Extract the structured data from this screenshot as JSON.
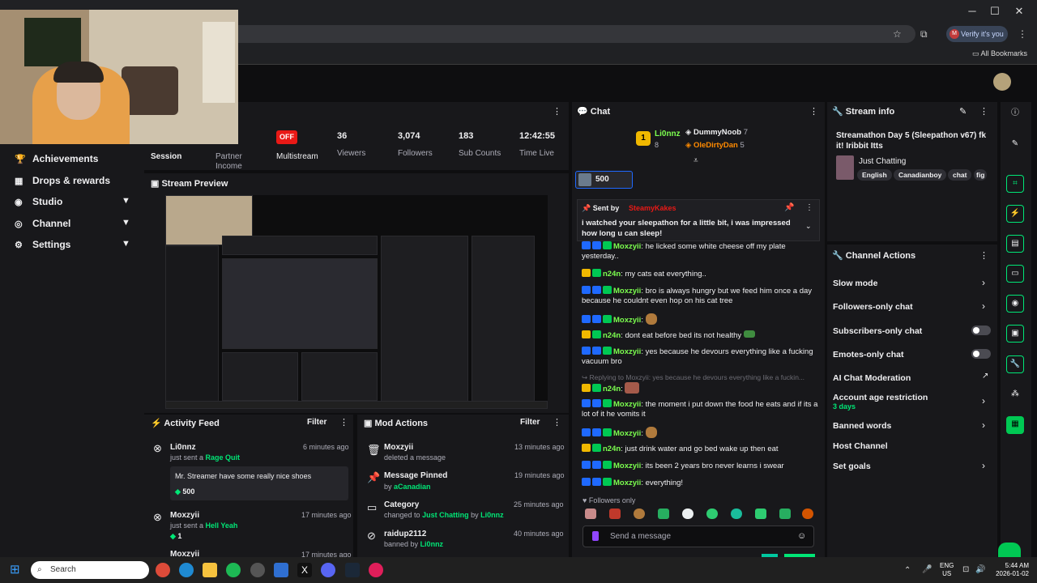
{
  "browser": {
    "verify_label": "Verify it's you",
    "verify_initial": "M",
    "all_bookmarks": "All Bookmarks"
  },
  "nav": {
    "items": [
      {
        "label": "Achievements"
      },
      {
        "label": "Drops & rewards"
      },
      {
        "label": "Studio"
      },
      {
        "label": "Channel"
      },
      {
        "label": "Settings"
      }
    ]
  },
  "stats": {
    "session": "Session",
    "partner_income": "Partner Income",
    "multistream_badge": "OFF",
    "multistream": "Multistream",
    "viewers_value": "36",
    "viewers": "Viewers",
    "followers_value": "3,074",
    "followers": "Followers",
    "subs_value": "183",
    "subs": "Sub Counts",
    "time_value": "12:42:55",
    "time": "Time Live"
  },
  "preview": {
    "title": "Stream Preview"
  },
  "activity": {
    "title": "Activity Feed",
    "filter": "Filter",
    "items": [
      {
        "user": "Li0nnz",
        "time": "6 minutes ago",
        "action": "just sent a",
        "reward": "Rage Quit",
        "message": "Mr. Streamer have some really nice shoes",
        "amount": "500"
      },
      {
        "user": "Moxzyii",
        "time": "17 minutes ago",
        "action": "just sent a",
        "reward": "Hell Yeah",
        "amount": "1"
      },
      {
        "user": "Moxzyii",
        "time": "17 minutes ago"
      }
    ]
  },
  "mod": {
    "title": "Mod Actions",
    "filter": "Filter",
    "items": [
      {
        "title": "Moxzyii",
        "sub": "deleted a message",
        "time": "13 minutes ago"
      },
      {
        "title": "Message Pinned",
        "sub_prefix": "by",
        "sub_user": "aCanadian",
        "time": "19 minutes ago"
      },
      {
        "title": "Category",
        "sub_prefix": "changed to",
        "sub_user": "Just Chatting",
        "sub_mid": "by",
        "sub_user2": "Li0nnz",
        "time": "25 minutes ago"
      },
      {
        "title": "raidup2112",
        "sub_prefix": "banned by",
        "sub_user": "Li0nnz",
        "time": "40 minutes ago"
      }
    ]
  },
  "chat": {
    "title": "Chat",
    "leader_rank": "1",
    "leader_name": "Li0nnz",
    "leader_count": "8",
    "second_name": "DummyNoob",
    "second_count": "7",
    "third_name": "OleDirtyDan",
    "third_count": "5",
    "hype_value": "500",
    "pinned_label": "Sent by",
    "pinned_user": "SteamyKakes",
    "pinned_message": "i watched your sleepathon for a little bit, i was impressed how long u can sleep!",
    "messages": [
      {
        "user": "Moxzyii",
        "text": "he licked some white cheese off my plate yesterday.."
      },
      {
        "user": "n24n",
        "text": "my cats eat everything.."
      },
      {
        "user": "Moxzyii",
        "text": "bro is always hungry but we feed him once a day because he couldnt even hop on his cat tree"
      },
      {
        "user": "Moxzyii",
        "text": ""
      },
      {
        "user": "n24n",
        "text": "dont eat before bed its not healthy"
      },
      {
        "user": "Moxzyii",
        "text": "yes because he devours everything like a fucking vacuum bro"
      },
      {
        "reply": "Replying to Moxzyii: yes because he devours everything like a fuckin..."
      },
      {
        "user": "n24n",
        "text": ""
      },
      {
        "user": "Moxzyii",
        "text": "the moment i put down the food he eats and if its a lot of it he vomits it"
      },
      {
        "user": "Moxzyii",
        "text": ""
      },
      {
        "user": "n24n",
        "text": "just drink water and go bed wake up then eat"
      },
      {
        "user": "Moxzyii",
        "text": "its been 2 years bro never learns i swear"
      },
      {
        "user": "Moxzyii",
        "text": "everything!"
      }
    ],
    "followers_only": "Followers only",
    "input_placeholder": "Send a message"
  },
  "stream_info": {
    "title": "Stream info",
    "stream_title": "Streamathon Day 5 (Sleepathon v67) fk it! Iribbit Itts",
    "category": "Just Chatting",
    "tags": [
      "English",
      "Canadianboy",
      "chat",
      "fig"
    ]
  },
  "channel_actions": {
    "title": "Channel Actions",
    "items": [
      {
        "label": "Slow mode"
      },
      {
        "label": "Followers-only chat"
      },
      {
        "label": "Subscribers-only chat"
      },
      {
        "label": "Emotes-only chat"
      },
      {
        "label": "AI Chat Moderation"
      },
      {
        "label": "Account age restriction",
        "sub": "3 days"
      },
      {
        "label": "Banned words"
      },
      {
        "label": "Host Channel"
      },
      {
        "label": "Set goals"
      }
    ]
  },
  "taskbar": {
    "search": "Search",
    "lang": "ENG",
    "region": "US",
    "time": "5:44 AM",
    "date": "2026-01-02"
  },
  "colors": {
    "accent": "#00e676",
    "live_red": "#e91916",
    "panel": "#18181b",
    "bg": "#0e0e10"
  }
}
